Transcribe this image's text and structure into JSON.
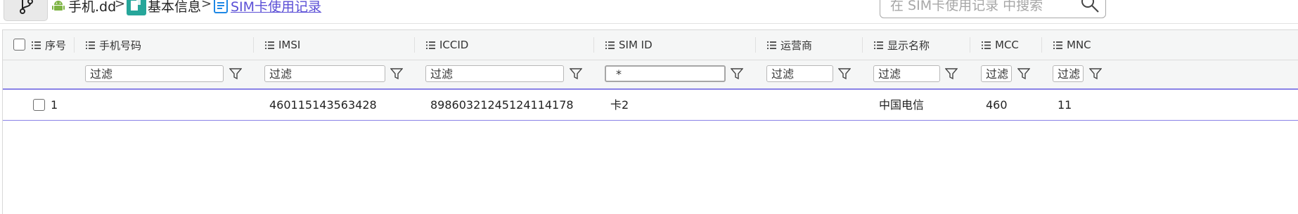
{
  "toolbar": {
    "branch_icon": "git-branch-icon"
  },
  "breadcrumb": {
    "items": [
      {
        "label": "手机.dd",
        "icon": "android-icon"
      },
      {
        "label": "基本信息",
        "icon": "document-icon"
      },
      {
        "label": "SIM卡使用记录",
        "icon": "list-doc-icon"
      }
    ],
    "separator": ">"
  },
  "search": {
    "placeholder": "在 SIM卡使用记录 中搜索",
    "icon": "search-icon"
  },
  "table": {
    "columns": [
      "序号",
      "手机号码",
      "IMSI",
      "ICCID",
      "SIM ID",
      "运营商",
      "显示名称",
      "MCC",
      "MNC"
    ],
    "filters": [
      "过滤",
      "过滤",
      "过滤",
      "*",
      "过滤",
      "过滤",
      "过滤",
      "过滤"
    ],
    "rows": [
      {
        "index": "1",
        "phone": "",
        "imsi": "460115143563428",
        "iccid": "89860321245124114178",
        "sim_id": "卡2",
        "carrier": "",
        "display_name": "中国电信",
        "mcc": "460",
        "mnc": "11"
      }
    ]
  },
  "colors": {
    "accent": "#8a82e6",
    "link": "#5b4fd6",
    "header_bg": "#f5f6f6"
  }
}
